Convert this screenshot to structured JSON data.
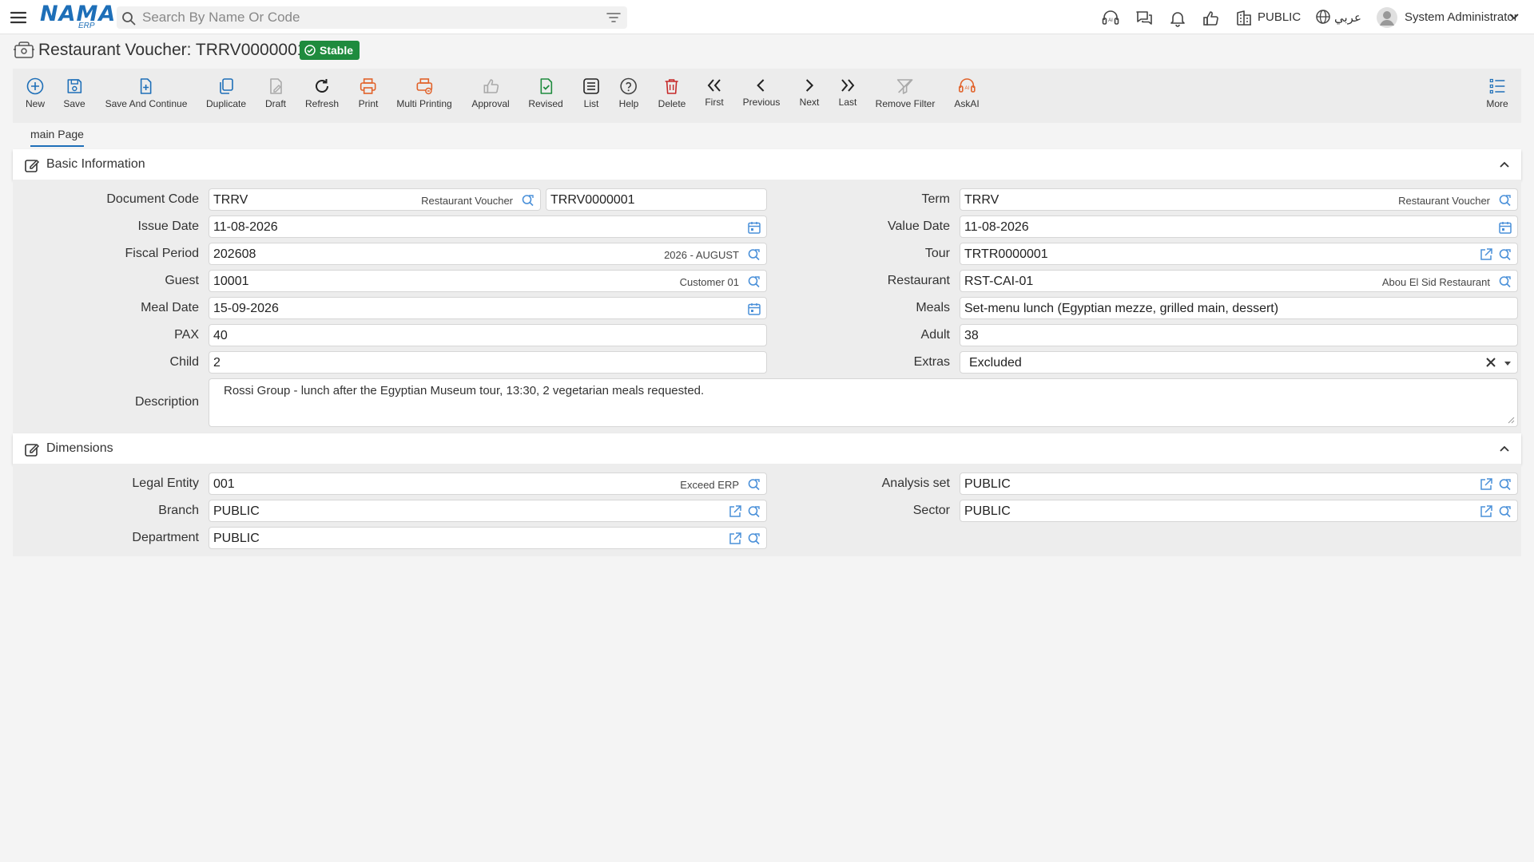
{
  "header": {
    "logo": "NAMA",
    "logo_sub": "ERP",
    "search_placeholder": "Search By Name Or Code",
    "company": "PUBLIC",
    "language": "عربي",
    "user": "System Administrator"
  },
  "page": {
    "title": "Restaurant Voucher: TRRV0000001",
    "status": "Stable"
  },
  "toolbar": {
    "new": "New",
    "save": "Save",
    "save_continue": "Save And Continue",
    "duplicate": "Duplicate",
    "draft": "Draft",
    "refresh": "Refresh",
    "print": "Print",
    "multi_printing": "Multi Printing",
    "approval": "Approval",
    "revised": "Revised",
    "list": "List",
    "help": "Help",
    "delete": "Delete",
    "first": "First",
    "previous": "Previous",
    "next": "Next",
    "last": "Last",
    "remove_filter": "Remove Filter",
    "askai": "AskAI",
    "more": "More"
  },
  "tabs": {
    "main": "main Page"
  },
  "basic": {
    "title": "Basic Information",
    "document_code": {
      "label": "Document Code",
      "value": "TRRV",
      "desc": "Restaurant Voucher",
      "code": "TRRV0000001"
    },
    "term": {
      "label": "Term",
      "value": "TRRV",
      "desc": "Restaurant Voucher"
    },
    "issue_date": {
      "label": "Issue Date",
      "value": "11-08-2026"
    },
    "value_date": {
      "label": "Value Date",
      "value": "11-08-2026"
    },
    "fiscal_period": {
      "label": "Fiscal Period",
      "value": "202608",
      "desc": "2026 - AUGUST"
    },
    "tour": {
      "label": "Tour",
      "value": "TRTR0000001"
    },
    "guest": {
      "label": "Guest",
      "value": "10001",
      "desc": "Customer 01"
    },
    "restaurant": {
      "label": "Restaurant",
      "value": "RST-CAI-01",
      "desc": "Abou El Sid Restaurant"
    },
    "meal_date": {
      "label": "Meal Date",
      "value": "15-09-2026"
    },
    "meals": {
      "label": "Meals",
      "value": "Set-menu lunch (Egyptian mezze, grilled main, dessert)"
    },
    "pax": {
      "label": "PAX",
      "value": "40"
    },
    "adult": {
      "label": "Adult",
      "value": "38"
    },
    "child": {
      "label": "Child",
      "value": "2"
    },
    "extras": {
      "label": "Extras",
      "value": "Excluded"
    },
    "description": {
      "label": "Description",
      "value": "Rossi Group - lunch after the Egyptian Museum tour, 13:30, 2 vegetarian meals requested."
    }
  },
  "dimensions": {
    "title": "Dimensions",
    "legal_entity": {
      "label": "Legal Entity",
      "value": "001",
      "desc": "Exceed ERP"
    },
    "analysis_set": {
      "label": "Analysis set",
      "value": "PUBLIC"
    },
    "branch": {
      "label": "Branch",
      "value": "PUBLIC"
    },
    "sector": {
      "label": "Sector",
      "value": "PUBLIC"
    },
    "department": {
      "label": "Department",
      "value": "PUBLIC"
    }
  }
}
